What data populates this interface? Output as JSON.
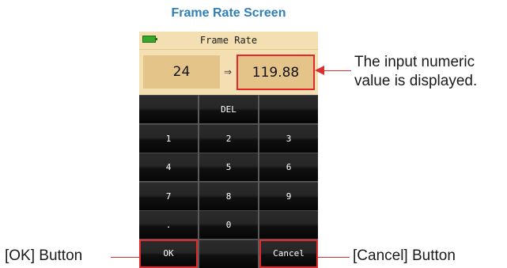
{
  "heading": "Frame Rate Screen",
  "screen": {
    "title": "Frame Rate",
    "input_value": "24",
    "arrow": "⇒",
    "output_value": "119.88"
  },
  "keypad": {
    "keys": [
      {
        "label": "",
        "name": "key-blank-1",
        "highlight": false
      },
      {
        "label": "DEL",
        "name": "key-del",
        "highlight": false
      },
      {
        "label": "",
        "name": "key-blank-2",
        "highlight": false
      },
      {
        "label": "1",
        "name": "key-1",
        "highlight": false
      },
      {
        "label": "2",
        "name": "key-2",
        "highlight": false
      },
      {
        "label": "3",
        "name": "key-3",
        "highlight": false
      },
      {
        "label": "4",
        "name": "key-4",
        "highlight": false
      },
      {
        "label": "5",
        "name": "key-5",
        "highlight": false
      },
      {
        "label": "6",
        "name": "key-6",
        "highlight": false
      },
      {
        "label": "7",
        "name": "key-7",
        "highlight": false
      },
      {
        "label": "8",
        "name": "key-8",
        "highlight": false
      },
      {
        "label": "9",
        "name": "key-9",
        "highlight": false
      },
      {
        "label": ".",
        "name": "key-decimal",
        "highlight": false
      },
      {
        "label": "0",
        "name": "key-0",
        "highlight": false
      },
      {
        "label": "",
        "name": "key-blank-3",
        "highlight": false
      },
      {
        "label": "OK",
        "name": "ok-button",
        "highlight": true
      },
      {
        "label": "",
        "name": "key-blank-4",
        "highlight": false
      },
      {
        "label": "Cancel",
        "name": "cancel-button",
        "highlight": true
      }
    ]
  },
  "callouts": {
    "input_line1": "The input numeric",
    "input_line2": "value is displayed.",
    "ok": "[OK] Button",
    "cancel": "[Cancel] Button"
  },
  "colors": {
    "heading": "#2f7fb8",
    "highlight": "#e02a2a",
    "screen_bg": "#f4dfb2",
    "field_bg": "#e5c489",
    "battery": "#3aa72a"
  }
}
